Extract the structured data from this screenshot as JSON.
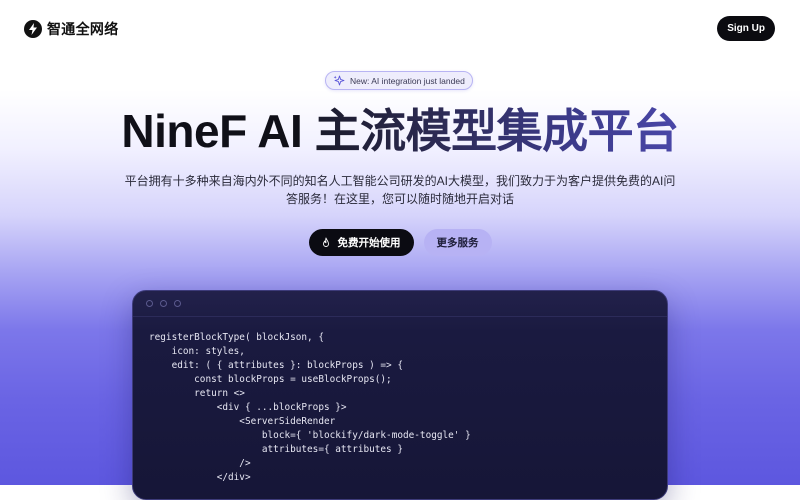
{
  "header": {
    "brand_name": "智通全网络",
    "brand_icon": "lightning-bolt-icon",
    "signup_label": "Sign Up"
  },
  "badge": {
    "icon": "sparkle-icon",
    "text": "New: AI integration just landed"
  },
  "hero": {
    "title_part1": "NineF AI ",
    "title_part2": "主流模型集成平台",
    "description": "平台拥有十多种来自海内外不同的知名人工智能公司研发的AI大模型，我们致力于为客户提供免费的AI问答服务！在这里，您可以随时随地开启对话"
  },
  "cta": {
    "primary_label": "免费开始使用",
    "primary_icon": "flame-icon",
    "secondary_label": "更多服务"
  },
  "code_window": {
    "lines": [
      "registerBlockType( blockJson, {",
      "    icon: styles,",
      "    edit: ( { attributes }: blockProps ) => {",
      "        const blockProps = useBlockProps();",
      "        return <>",
      "            <div { ...blockProps }>",
      "                <ServerSideRender",
      "                    block={ 'blockify/dark-mode-toggle' }",
      "                    attributes={ attributes }",
      "                />",
      "            </div>"
    ]
  },
  "colors": {
    "accent": "#5d57df",
    "button_dark": "#0b0b12",
    "secondary_button": "#b7b2f4",
    "code_bg": "#1a1a40"
  }
}
